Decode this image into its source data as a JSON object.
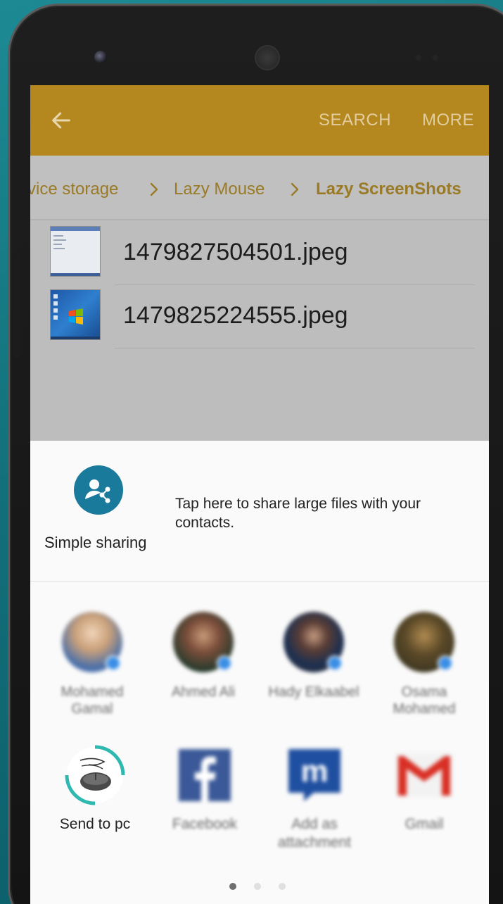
{
  "toolbar": {
    "back_icon": "arrow-left-icon",
    "search_label": "SEARCH",
    "more_label": "MORE",
    "accent_color": "#b4881e"
  },
  "breadcrumb": {
    "items": [
      "vice storage",
      "Lazy Mouse",
      "Lazy ScreenShots"
    ],
    "separator_icon": "chevron-right-icon"
  },
  "files": [
    {
      "name": "1479827504501.jpeg",
      "thumb_icon": "screenshot-thumbnail"
    },
    {
      "name": "1479825224555.jpeg",
      "thumb_icon": "windows-desktop-thumbnail"
    }
  ],
  "share_sheet": {
    "simple_sharing": {
      "label": "Simple sharing",
      "description": "Tap here to share large files with your contacts.",
      "icon": "simple-sharing-icon",
      "icon_color": "#197a9c"
    },
    "contacts": [
      {
        "name": "Mohamed Gamal"
      },
      {
        "name": "Ahmed Ali"
      },
      {
        "name": "Hady Elkaabel"
      },
      {
        "name": "Osama Mohamed"
      }
    ],
    "apps": [
      {
        "label": "Send to pc",
        "icon": "mouse-icon"
      },
      {
        "label": "Facebook",
        "icon": "facebook-icon"
      },
      {
        "label": "Add as attachment",
        "icon": "m-mail-icon"
      },
      {
        "label": "Gmail",
        "icon": "gmail-icon"
      }
    ],
    "pager": {
      "pages": 3,
      "current": 1
    }
  }
}
